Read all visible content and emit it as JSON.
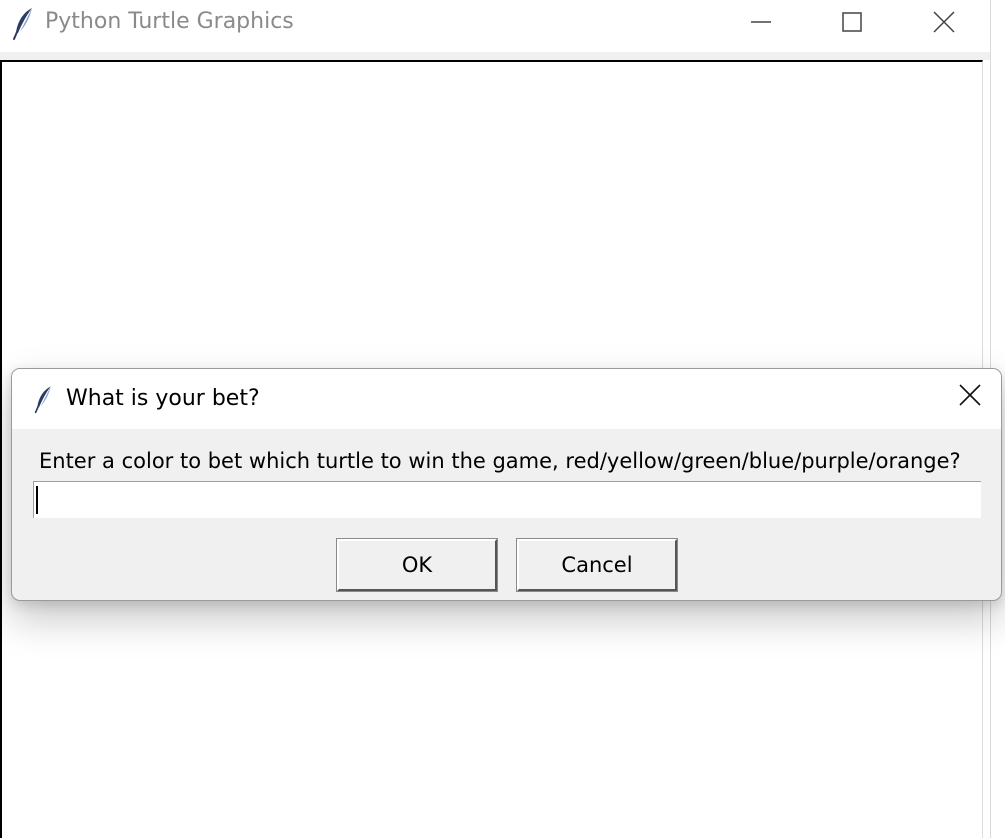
{
  "window": {
    "title": "Python Turtle Graphics",
    "controls": [
      "minimize",
      "maximize",
      "close"
    ]
  },
  "dialog": {
    "title": "What is your bet?",
    "prompt": "Enter a color to bet which turtle to win the game, red/yellow/green/blue/purple/orange?",
    "input_value": "",
    "ok_label": "OK",
    "cancel_label": "Cancel"
  },
  "icons": {
    "app": "tk-feather-icon",
    "minimize": "minimize-icon",
    "maximize": "maximize-icon",
    "close": "close-icon"
  },
  "colors": {
    "window_title_text": "#8a8a8a",
    "dialog_body": "#f0f0f0",
    "feather_dark": "#2b3c63",
    "feather_light": "#8fa6c9"
  }
}
